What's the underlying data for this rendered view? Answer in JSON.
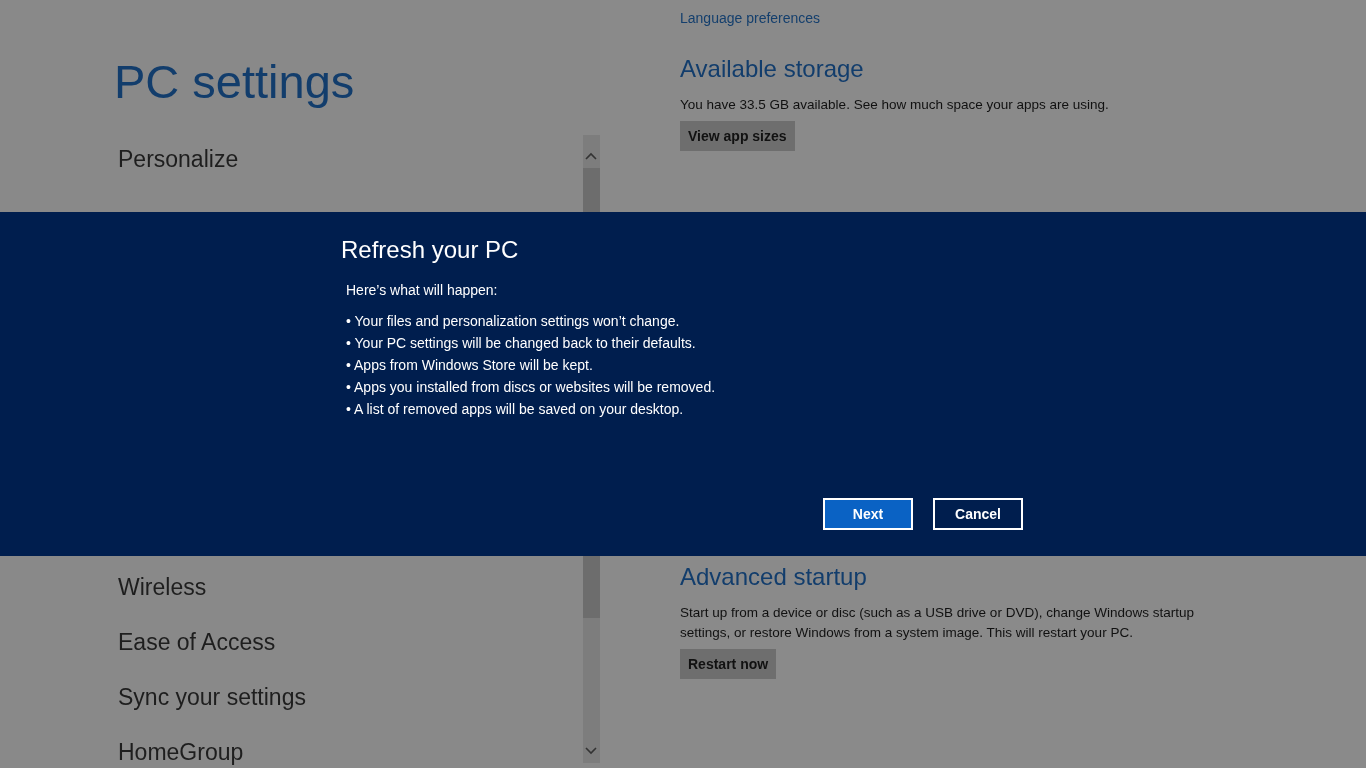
{
  "sidebar": {
    "title": "PC settings",
    "items": [
      "Personalize",
      "Wireless",
      "Ease of Access",
      "Sync your settings",
      "HomeGroup"
    ]
  },
  "content": {
    "link": "Language preferences",
    "sections": [
      {
        "heading": "Available storage",
        "text": "You have 33.5 GB available. See how much space your apps are using.",
        "button": "View app sizes"
      },
      {
        "heading": "Advanced startup",
        "text": "Start up from a device or disc (such as a USB drive or DVD), change Windows startup settings, or restore Windows from a system image. This will restart your PC.",
        "button": "Restart now"
      }
    ]
  },
  "dialog": {
    "title": "Refresh your PC",
    "intro": "Here’s what will happen:",
    "bullets": [
      "• Your files and personalization settings won’t change.",
      "• Your PC settings will be changed back to their defaults.",
      "• Apps from Windows Store will be kept.",
      "• Apps you installed from discs or websites will be removed.",
      "• A list of removed apps will be saved on your desktop."
    ],
    "buttons": [
      {
        "label": "Next",
        "kind": "primary"
      },
      {
        "label": "Cancel",
        "kind": "secondary"
      }
    ]
  }
}
